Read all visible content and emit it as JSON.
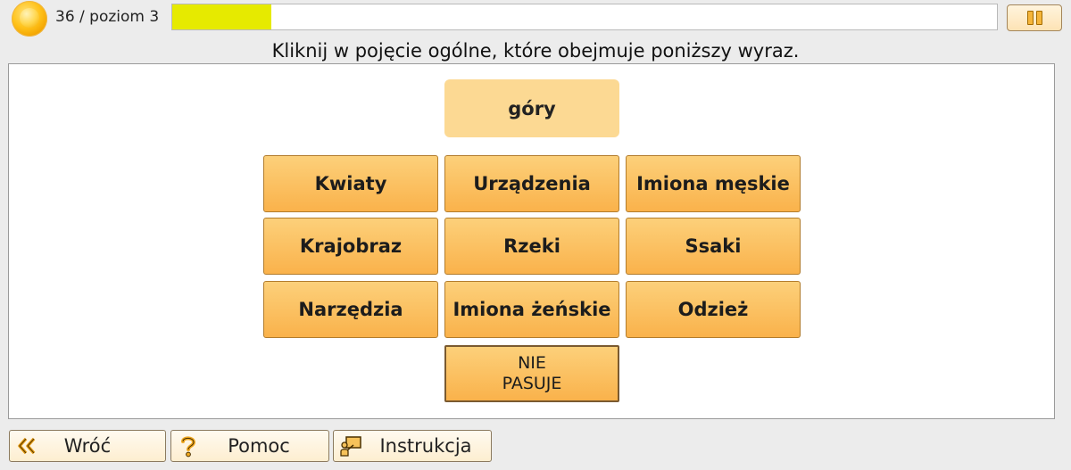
{
  "header": {
    "score_text": "36 / poziom 3",
    "progress": 0.12
  },
  "instruction": "Kliknij w pojęcie ogólne, które obejmuje poniższy wyraz.",
  "word": "góry",
  "options": [
    "Kwiaty",
    "Urządzenia",
    "Imiona męskie",
    "Krajobraz",
    "Rzeki",
    "Ssaki",
    "Narzędzia",
    "Imiona żeńskie",
    "Odzież"
  ],
  "nie_pasuje": {
    "line1": "NIE",
    "line2": "PASUJE"
  },
  "footer": {
    "back_label": "Wróć",
    "help_label": "Pomoc",
    "instructions_label": "Instrukcja"
  },
  "colors": {
    "accent_orange": "#fab24b",
    "progress_yellow": "#e6ea00",
    "word_card": "#fcd993"
  }
}
